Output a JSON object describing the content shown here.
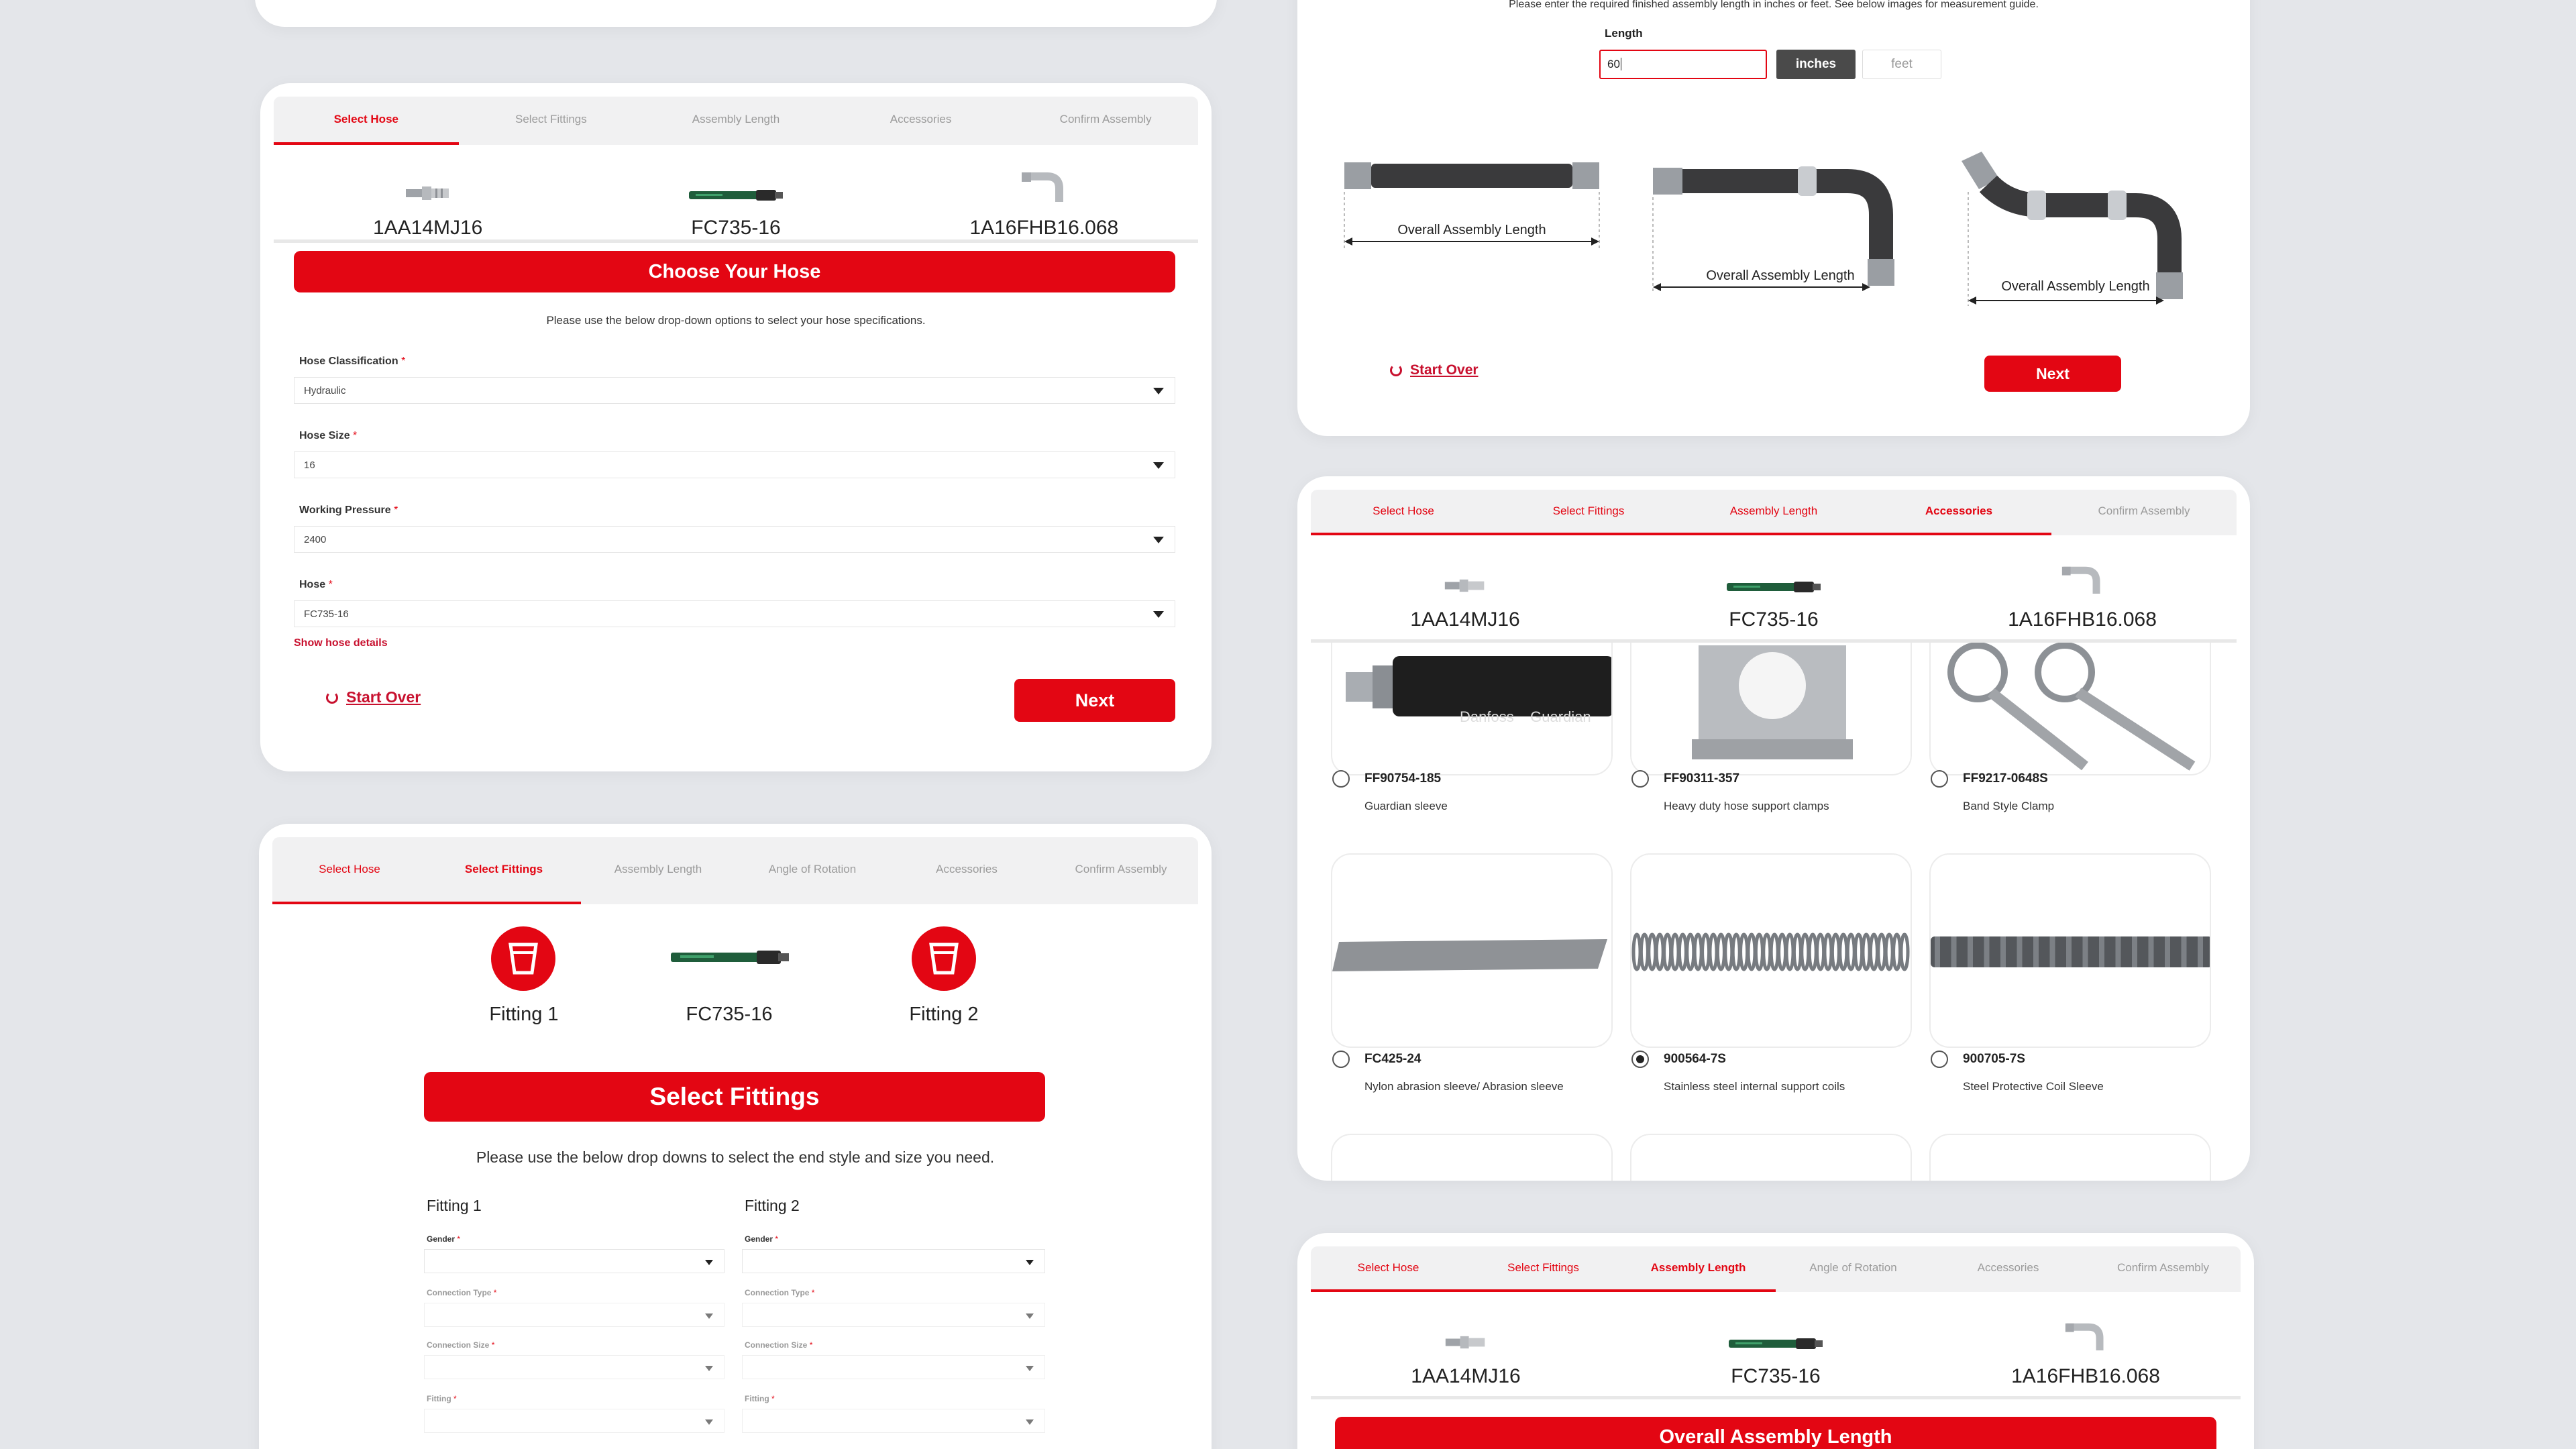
{
  "colors": {
    "brand_red": "#e30613",
    "bg": "#e4e6ea",
    "tab_bg": "#f1f1f2"
  },
  "select_hose_card": {
    "tabs": [
      {
        "label": "Select Hose",
        "state": "active"
      },
      {
        "label": "Select Fittings",
        "state": "inactive"
      },
      {
        "label": "Assembly Length",
        "state": "inactive"
      },
      {
        "label": "Accessories",
        "state": "inactive"
      },
      {
        "label": "Confirm Assembly",
        "state": "inactive"
      }
    ],
    "summary": [
      {
        "label": "1AA14MJ16",
        "icon": "fitting-icon"
      },
      {
        "label": "FC735-16",
        "icon": "hose-icon"
      },
      {
        "label": "1A16FHB16.068",
        "icon": "elbow-fitting-icon"
      }
    ],
    "heading": "Choose Your Hose",
    "help": "Please use the below drop-down options to select your hose specifications.",
    "fields": {
      "classification": {
        "label": "Hose Classification",
        "value": "Hydraulic"
      },
      "size": {
        "label": "Hose Size",
        "value": "16"
      },
      "pressure": {
        "label": "Working Pressure",
        "value": "2400"
      },
      "hose": {
        "label": "Hose",
        "value": "FC735-16"
      }
    },
    "required_mark": "*",
    "show_details": "Show hose details",
    "start_over": "Start Over",
    "next": "Next"
  },
  "select_fittings_card": {
    "tabs": [
      {
        "label": "Select Hose",
        "state": "done"
      },
      {
        "label": "Select Fittings",
        "state": "active"
      },
      {
        "label": "Assembly Length",
        "state": "inactive"
      },
      {
        "label": "Angle of Rotation",
        "state": "inactive"
      },
      {
        "label": "Accessories",
        "state": "inactive"
      },
      {
        "label": "Confirm Assembly",
        "state": "inactive"
      }
    ],
    "summary": [
      {
        "label": "Fitting 1",
        "icon": "fitting-cup-icon"
      },
      {
        "label": "FC735-16",
        "icon": "hose-icon"
      },
      {
        "label": "Fitting 2",
        "icon": "fitting-cup-icon"
      }
    ],
    "heading": "Select Fittings",
    "help": "Please use the below drop downs to select the end style and size you need.",
    "fitting1": {
      "title": "Fitting 1",
      "gender": "Gender",
      "connection_type": "Connection Type",
      "connection_size": "Connection Size",
      "fitting": "Fitting"
    },
    "fitting2": {
      "title": "Fitting 2",
      "gender": "Gender",
      "connection_type": "Connection Type",
      "connection_size": "Connection Size",
      "fitting": "Fitting"
    }
  },
  "length_card": {
    "instruction": "Please enter the required finished assembly length in inches or feet. See below images for measurement guide.",
    "length_label": "Length",
    "length_value": "60",
    "unit_inches": "inches",
    "unit_feet": "feet",
    "diagram_label": "Overall Assembly Length",
    "start_over": "Start Over",
    "next": "Next"
  },
  "accessories_card": {
    "tabs": [
      {
        "label": "Select Hose",
        "state": "done"
      },
      {
        "label": "Select Fittings",
        "state": "done"
      },
      {
        "label": "Assembly Length",
        "state": "done"
      },
      {
        "label": "Accessories",
        "state": "active"
      },
      {
        "label": "Confirm Assembly",
        "state": "inactive"
      }
    ],
    "summary": [
      {
        "label": "1AA14MJ16",
        "icon": "fitting-icon"
      },
      {
        "label": "FC735-16",
        "icon": "hose-icon"
      },
      {
        "label": "1A16FHB16.068",
        "icon": "elbow-fitting-icon"
      }
    ],
    "items": [
      {
        "code": "FF90754-185",
        "desc": "Guardian sleeve",
        "selected": false,
        "image_text": "Danfoss    Guardian"
      },
      {
        "code": "FF90311-357",
        "desc": "Heavy duty hose support clamps",
        "selected": false
      },
      {
        "code": "FF9217-0648S",
        "desc": "Band Style Clamp",
        "selected": false
      },
      {
        "code": "FC425-24",
        "desc": "Nylon abrasion sleeve/ Abrasion sleeve",
        "selected": false
      },
      {
        "code": "900564-7S",
        "desc": "Stainless steel internal support coils",
        "selected": true
      },
      {
        "code": "900705-7S",
        "desc": "Steel Protective Coil Sleeve",
        "selected": false
      }
    ]
  },
  "assembly_length_card": {
    "tabs": [
      {
        "label": "Select Hose",
        "state": "done"
      },
      {
        "label": "Select Fittings",
        "state": "done"
      },
      {
        "label": "Assembly Length",
        "state": "active"
      },
      {
        "label": "Angle of Rotation",
        "state": "inactive"
      },
      {
        "label": "Accessories",
        "state": "inactive"
      },
      {
        "label": "Confirm Assembly",
        "state": "inactive"
      }
    ],
    "summary": [
      {
        "label": "1AA14MJ16",
        "icon": "fitting-icon"
      },
      {
        "label": "FC735-16",
        "icon": "hose-icon"
      },
      {
        "label": "1A16FHB16.068",
        "icon": "elbow-fitting-icon"
      }
    ],
    "heading": "Overall Assembly Length"
  }
}
